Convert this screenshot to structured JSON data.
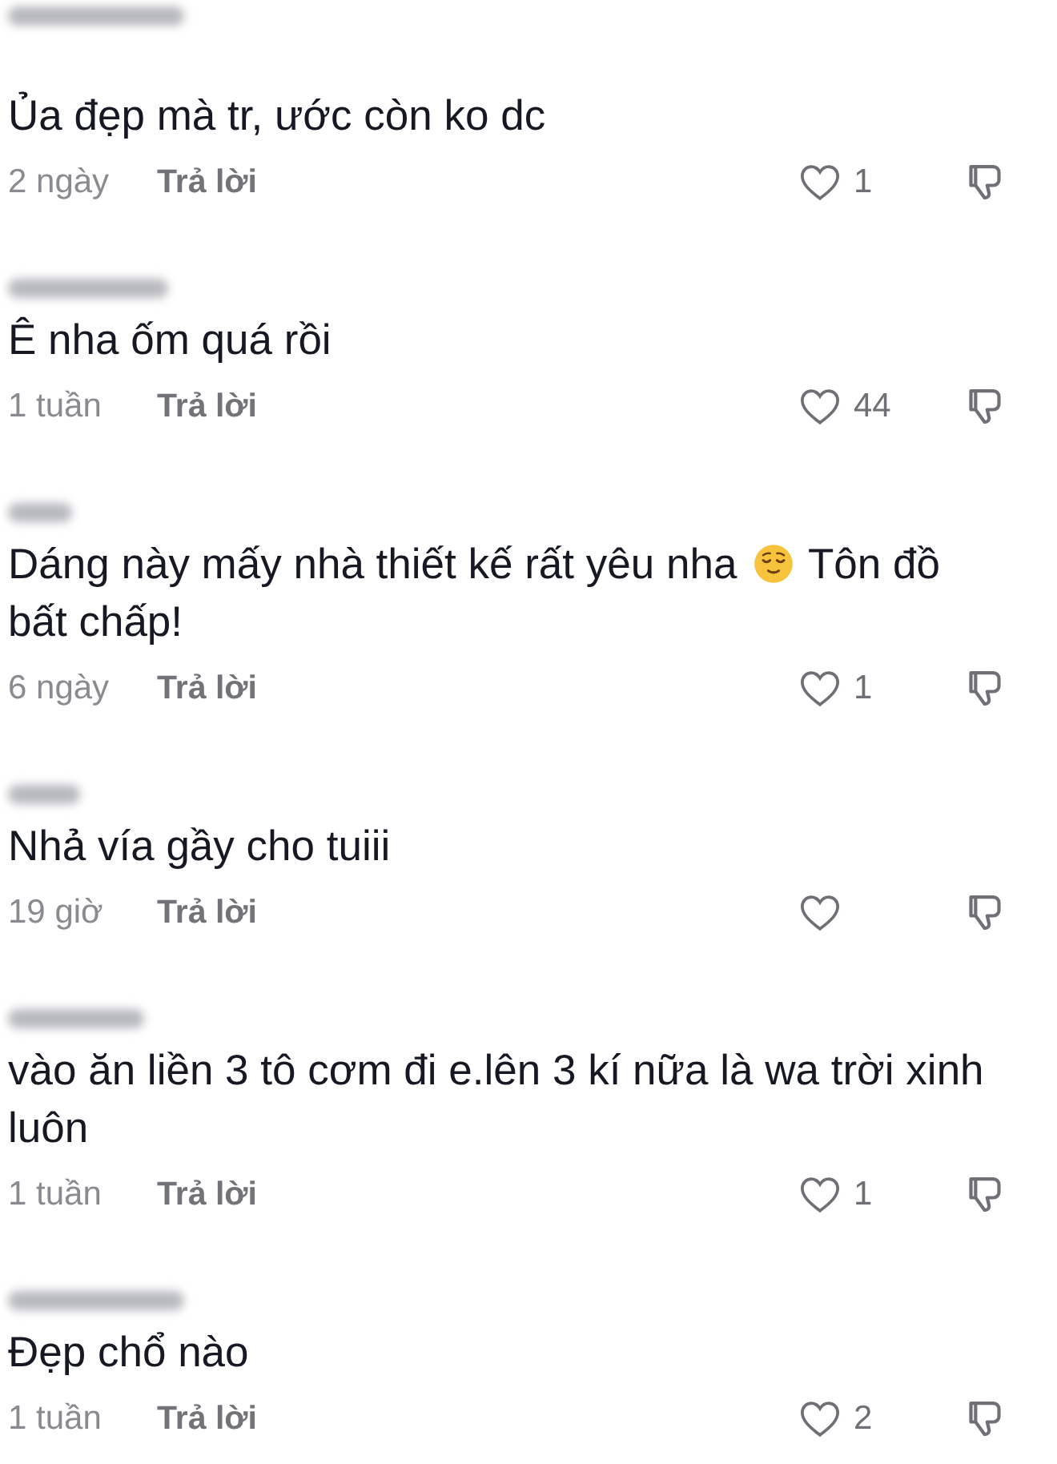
{
  "comments": [
    {
      "parts": [
        {
          "kind": "text",
          "text": "Ủa đẹp mà tr, ước còn ko dc"
        }
      ],
      "time": "2 ngày",
      "reply": "Trả lời",
      "liked": false,
      "likes": "1"
    },
    {
      "parts": [
        {
          "kind": "text",
          "text": "Ê nha ốm quá rồi"
        }
      ],
      "time": "1 tuần",
      "reply": "Trả lời",
      "liked": false,
      "likes": "44"
    },
    {
      "parts": [
        {
          "kind": "text",
          "text": "Dáng này mấy nhà thiết kế rất yêu nha"
        },
        {
          "kind": "emoji"
        },
        {
          "kind": "text",
          "text": "Tôn đồ"
        },
        {
          "kind": "text",
          "text": "bất chấp!"
        }
      ],
      "time": "6 ngày",
      "reply": "Trả lời",
      "liked": false,
      "likes": "1"
    },
    {
      "parts": [
        {
          "kind": "text",
          "text": "Nhả vía gầy cho tuiii"
        }
      ],
      "time": "19 giờ",
      "reply": "Trả lời",
      "liked": false
    },
    {
      "parts": [
        {
          "kind": "text",
          "text": "vào ăn liền 3 tô cơm đi e.lên 3 kí nữa là wa trời xinh luôn"
        }
      ],
      "time": "1 tuần",
      "reply": "Trả lời",
      "liked": false,
      "likes": "1"
    },
    {
      "parts": [
        {
          "kind": "text",
          "text": "Đẹp chổ nào"
        }
      ],
      "time": "1 tuần",
      "reply": "Trả lời",
      "liked": false,
      "likes": "2"
    }
  ]
}
